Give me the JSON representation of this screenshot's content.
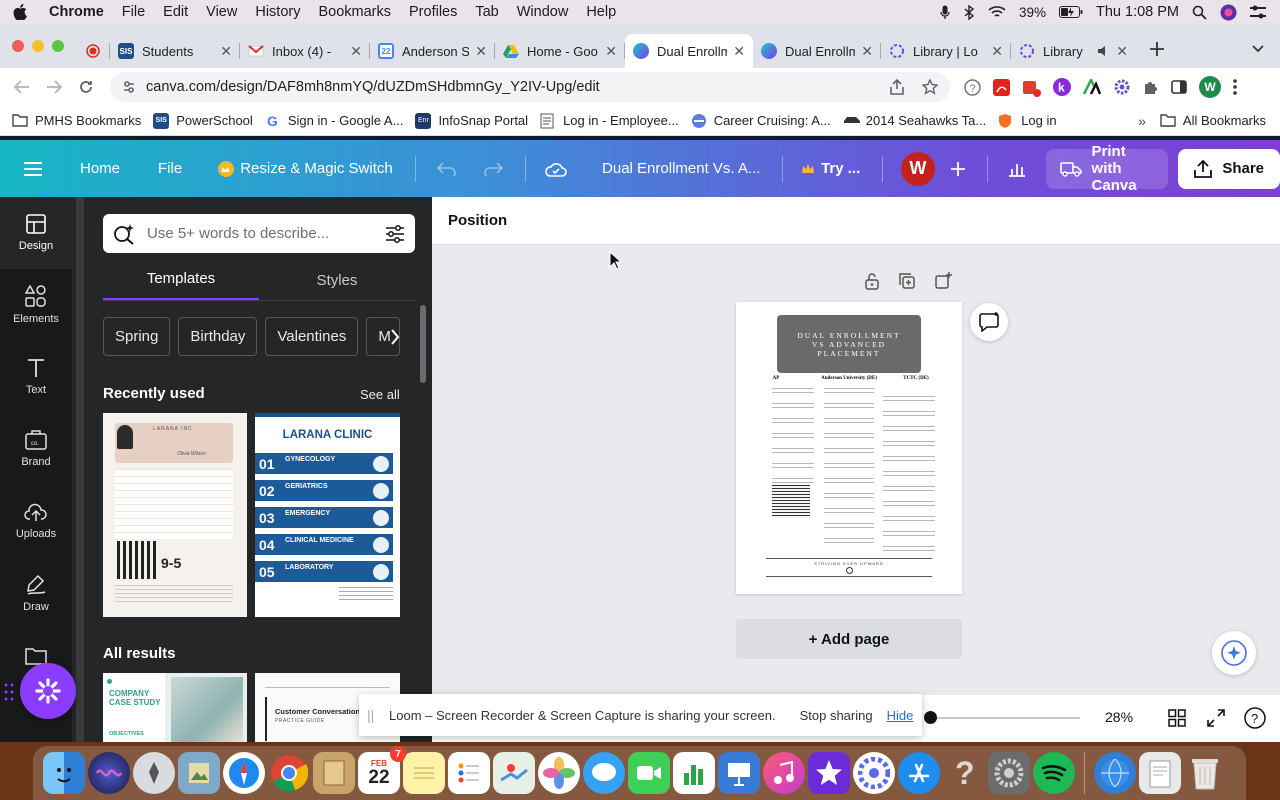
{
  "mac_menubar": {
    "app": "Chrome",
    "items": [
      "File",
      "Edit",
      "View",
      "History",
      "Bookmarks",
      "Profiles",
      "Tab",
      "Window",
      "Help"
    ],
    "battery": "39%",
    "clock": "Thu 1:08 PM"
  },
  "browser": {
    "tabs": [
      {
        "label": "Students",
        "favicon": "SIS"
      },
      {
        "label": "Inbox (4) - ",
        "favicon": "gmail"
      },
      {
        "label": "Anderson S",
        "favicon": "calendar"
      },
      {
        "label": "Home - Goo",
        "favicon": "drive"
      },
      {
        "label": "Dual Enrollm",
        "favicon": "canva",
        "active": true
      },
      {
        "label": "Dual Enrollm",
        "favicon": "canva"
      },
      {
        "label": "Library | Lo",
        "favicon": "library"
      },
      {
        "label": "Library",
        "favicon": "library"
      }
    ],
    "url": "canva.com/design/DAF8mh8nmYQ/dUZDmSHdbmnGy_Y2IV-Upg/edit",
    "profile_initial": "W",
    "bookmarks": [
      {
        "label": "PMHS Bookmarks",
        "icon": "folder"
      },
      {
        "label": "PowerSchool",
        "icon": "SIS"
      },
      {
        "label": "Sign in - Google A...",
        "icon": "google"
      },
      {
        "label": "InfoSnap Portal",
        "icon": "enr"
      },
      {
        "label": "Log in - Employee...",
        "icon": "doc"
      },
      {
        "label": "Career Cruising: A...",
        "icon": "cc"
      },
      {
        "label": "2014 Seahawks Ta...",
        "icon": "car"
      },
      {
        "label": "Log in",
        "icon": "shield"
      }
    ],
    "all_bookmarks": "All Bookmarks"
  },
  "canva_header": {
    "home": "Home",
    "file": "File",
    "resize": "Resize & Magic Switch",
    "doc_title": "Dual Enrollment Vs. A...",
    "try": "Try ...",
    "avatar": "W",
    "print": "Print with Canva",
    "share": "Share"
  },
  "rail": [
    {
      "label": "Design",
      "icon": "design-icon"
    },
    {
      "label": "Elements",
      "icon": "elements-icon"
    },
    {
      "label": "Text",
      "icon": "text-icon"
    },
    {
      "label": "Brand",
      "icon": "brand-icon"
    },
    {
      "label": "Uploads",
      "icon": "uploads-icon"
    },
    {
      "label": "Draw",
      "icon": "draw-icon"
    },
    {
      "label": "P",
      "icon": "projects-icon"
    }
  ],
  "panel": {
    "search_placeholder": "Use 5+ words to describe...",
    "tabs": [
      "Templates",
      "Styles"
    ],
    "chips": [
      "Spring",
      "Birthday",
      "Valentines",
      "M"
    ],
    "recently_used": "Recently used",
    "see_all": "See all",
    "all_results": "All results",
    "thumb1": {
      "brand": "LARANA INC",
      "sub": "Olivia Wilson",
      "big": "9-5"
    },
    "thumb2": {
      "title": "LARANA CLINIC",
      "rows": [
        {
          "num": "01",
          "label": "GYNECOLOGY"
        },
        {
          "num": "02",
          "label": "GERIATRICS"
        },
        {
          "num": "03",
          "label": "EMERGENCY"
        },
        {
          "num": "04",
          "label": "CLINICAL MEDICINE"
        },
        {
          "num": "05",
          "label": "LABORATORY"
        }
      ]
    },
    "thumb3": {
      "title": "COMPANY CASE STUDY",
      "sub": "OBJECTIVES"
    },
    "thumb4": {
      "title": "Customer Conversations",
      "sub": "PRACTICE GUIDE"
    }
  },
  "editor": {
    "context_title": "Position",
    "page": {
      "banner": "DUAL ENROLLMENT VS ADVANCED PLACEMENT",
      "cols": [
        "AP",
        "Anderson University (DE)",
        "TCTC (DE)"
      ],
      "footer": "STRIVING EVER UPWARD"
    },
    "add_page": "+ Add page",
    "zoom": "28%",
    "zoom_level": 0.28
  },
  "loom": {
    "message": "Loom – Screen Recorder & Screen Capture is sharing your screen.",
    "stop": "Stop sharing",
    "hide": "Hide"
  },
  "dock": {
    "calendar_month": "FEB",
    "calendar_day": "22",
    "badge": "7"
  }
}
